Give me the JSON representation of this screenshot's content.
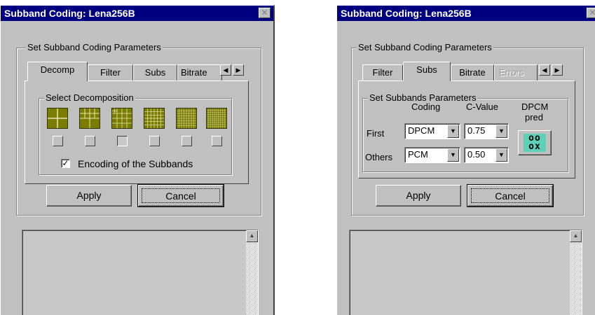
{
  "colors": {
    "title_bar": "#000080",
    "face": "#c0c0c0",
    "thumbnail_olive": "#7a7c00",
    "dpcm_icon_bg": "#5fd0b8"
  },
  "left_window": {
    "title": "Subband Coding: Lena256B",
    "group_label": "Set Subband Coding Parameters",
    "tabs": [
      {
        "label": "Decomp",
        "active": true
      },
      {
        "label": "Filter",
        "active": false
      },
      {
        "label": "Subs",
        "active": false
      },
      {
        "label": "Bitrate",
        "active": false
      }
    ],
    "decomposition_label": "Select Decomposition",
    "decomposition_options": [
      {
        "icon": "grid-2x2-icon",
        "selected": false
      },
      {
        "icon": "grid-mixed-icon",
        "selected": false
      },
      {
        "icon": "grid-4x4-icon",
        "selected": true
      },
      {
        "icon": "grid-6x6-icon",
        "selected": false
      },
      {
        "icon": "grid-8x8-icon",
        "selected": false
      },
      {
        "icon": "grid-10x10-icon",
        "selected": false
      }
    ],
    "encoding_label": "Encoding of the Subbands",
    "encoding_checked": true,
    "apply_label": "Apply",
    "cancel_label": "Cancel"
  },
  "right_window": {
    "title": "Subband Coding: Lena256B",
    "group_label": "Set Subband Coding Parameters",
    "tabs": [
      {
        "label": "Filter",
        "active": false
      },
      {
        "label": "Subs",
        "active": true
      },
      {
        "label": "Bitrate",
        "active": false
      },
      {
        "label": "Errors",
        "active": false,
        "disabled": true
      }
    ],
    "subbands_label": "Set Subbands Parameters",
    "coding_header": "Coding",
    "cvalue_header": "C-Value",
    "dpcm_pred_label_1": "DPCM",
    "dpcm_pred_label_2": "pred",
    "dpcm_icon_glyph_1": "oo",
    "dpcm_icon_glyph_2": "ox",
    "rows": [
      {
        "label": "First",
        "coding": "DPCM",
        "cvalue": "0.75"
      },
      {
        "label": "Others",
        "coding": "PCM",
        "cvalue": "0.50"
      }
    ],
    "apply_label": "Apply",
    "cancel_label": "Cancel"
  }
}
